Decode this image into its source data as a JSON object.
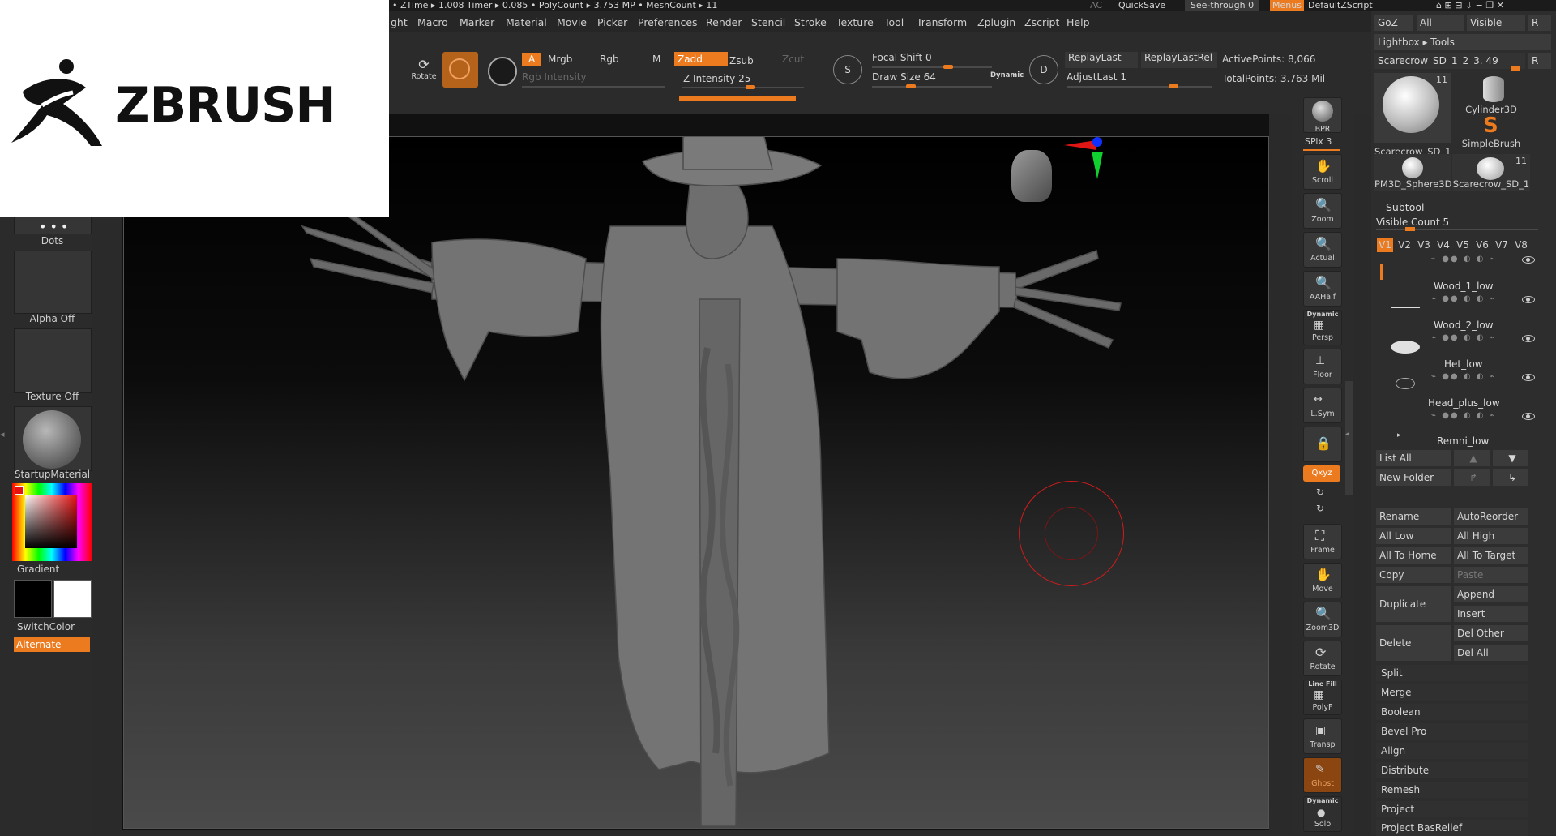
{
  "top_status": {
    "items": [
      "• ZTime ▸ 1.008 Timer ▸ 0.085 • PolyCount ▸ 3.753 MP • MeshCount ▸ 11",
      "AC",
      "QuickSave",
      "See-through  0",
      "Menus",
      "DefaultZScript"
    ]
  },
  "menu": [
    "ght",
    "Macro",
    "Marker",
    "Material",
    "Movie",
    "Picker",
    "Preferences",
    "Render",
    "Stencil",
    "Stroke",
    "Texture",
    "Tool",
    "Transform",
    "Zplugin",
    "Zscript",
    "Help"
  ],
  "logo": {
    "text": "ZBRUSH",
    "brand_color": "#111111"
  },
  "toolbar": {
    "rotate_label": "Rotate",
    "a_label": "A",
    "mrgb": "Mrgb",
    "rgb": "Rgb",
    "m": "M",
    "zadd": "Zadd",
    "zsub": "Zsub",
    "zcut": "Zcut",
    "rgb_intensity": "Rgb Intensity",
    "z_intensity": "Z Intensity 25",
    "focal_shift": "Focal Shift 0",
    "draw_size": "Draw Size 64",
    "dynamic": "Dynamic",
    "s_label": "S",
    "d_label": "D",
    "replay_last": "ReplayLast",
    "replay_last_rel": "ReplayLastRel",
    "adjust_last": "AdjustLast 1",
    "active_points": "ActivePoints: 8,066",
    "total_points": "TotalPoints: 3.763 Mil",
    "z_intensity_value": 0.25,
    "focal_shift_value": 0.5,
    "draw_size_value": 0.05,
    "adjust_last_value": 1
  },
  "left_shelf": {
    "dots": "Dots",
    "alpha": "Alpha Off",
    "texture": "Texture Off",
    "material": "StartupMaterial",
    "gradient": "Gradient",
    "switch_color": "SwitchColor",
    "alternate": "Alternate"
  },
  "right_shelf": {
    "bpr": "BPR",
    "spix": "SPix 3",
    "buttons": [
      "Scroll",
      "Zoom",
      "Actual",
      "AAHalf",
      "Persp",
      "Floor",
      "L.Sym",
      "Frame",
      "Move",
      "Zoom3D",
      "Rotate",
      "PolyF",
      "Transp",
      "Ghost",
      "Solo"
    ],
    "dynamic": "Dynamic",
    "xyz": "Qxyz",
    "line_fill": "Line Fill"
  },
  "palette": {
    "goz": "GoZ",
    "all": "All",
    "visible": "Visible",
    "r": "R",
    "lightbox": "Lightbox ▸ Tools",
    "current_tool": "Scarecrow_SD_1_2_3. 49",
    "tools": [
      {
        "name": "Scarecrow_SD_1",
        "count": "11"
      },
      {
        "name": "Cylinder3D",
        "count": ""
      },
      {
        "name": "SimpleBrush",
        "count": ""
      },
      {
        "name": "PM3D_Sphere3D",
        "count": ""
      },
      {
        "name": "Scarecrow_SD_1",
        "count": "11"
      }
    ],
    "subtool_title": "Subtool",
    "visible_count": "Visible Count 5",
    "versions": [
      "V1",
      "V2",
      "V3",
      "V4",
      "V5",
      "V6",
      "V7",
      "V8"
    ],
    "subtools": [
      "Wood_1_low",
      "Wood_2_low",
      "Het_low",
      "Head_plus_low",
      "Remni_low"
    ],
    "list_all": "List All",
    "new_folder": "New Folder",
    "buttons": {
      "rename": "Rename",
      "auto_reorder": "AutoReorder",
      "all_low": "All Low",
      "all_high": "All High",
      "all_to_home": "All To Home",
      "all_to_target": "All To Target",
      "copy": "Copy",
      "paste": "Paste",
      "duplicate": "Duplicate",
      "append": "Append",
      "insert": "Insert",
      "delete": "Delete",
      "del_other": "Del Other",
      "del_all": "Del All"
    },
    "sections": [
      "Split",
      "Merge",
      "Boolean",
      "Bevel Pro",
      "Align",
      "Distribute",
      "Remesh",
      "Project",
      "Project BasRelief"
    ]
  },
  "colors": {
    "accent": "#ec7a1e",
    "brush_cursor": "#d01c1c"
  }
}
